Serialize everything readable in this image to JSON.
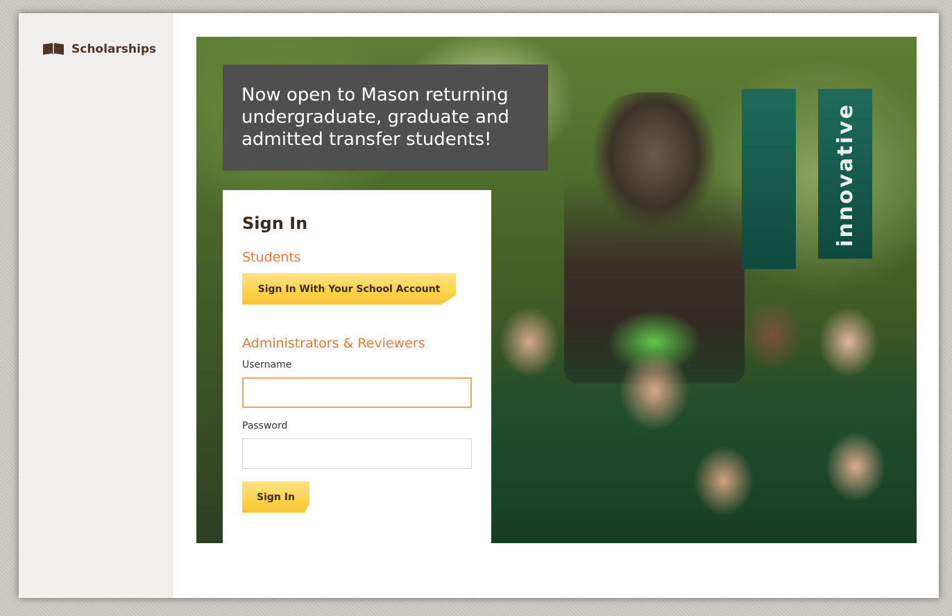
{
  "sidebar": {
    "brand_label": "Scholarships",
    "brand_icon": "book-icon"
  },
  "hero": {
    "announcement": "Now open to Mason returning undergraduate, graduate and admitted transfer students!",
    "banner_text": "innovative"
  },
  "signin": {
    "title": "Sign In",
    "students_heading": "Students",
    "school_account_button": "Sign In With Your School Account",
    "admin_heading": "Administrators & Reviewers",
    "username_label": "Username",
    "username_value": "",
    "password_label": "Password",
    "password_value": "",
    "submit_button": "Sign In"
  },
  "colors": {
    "accent_orange": "#e8773b",
    "button_yellow": "#ffd24a",
    "brand_brown": "#4e3527",
    "announce_bg": "#4f4f4f"
  }
}
